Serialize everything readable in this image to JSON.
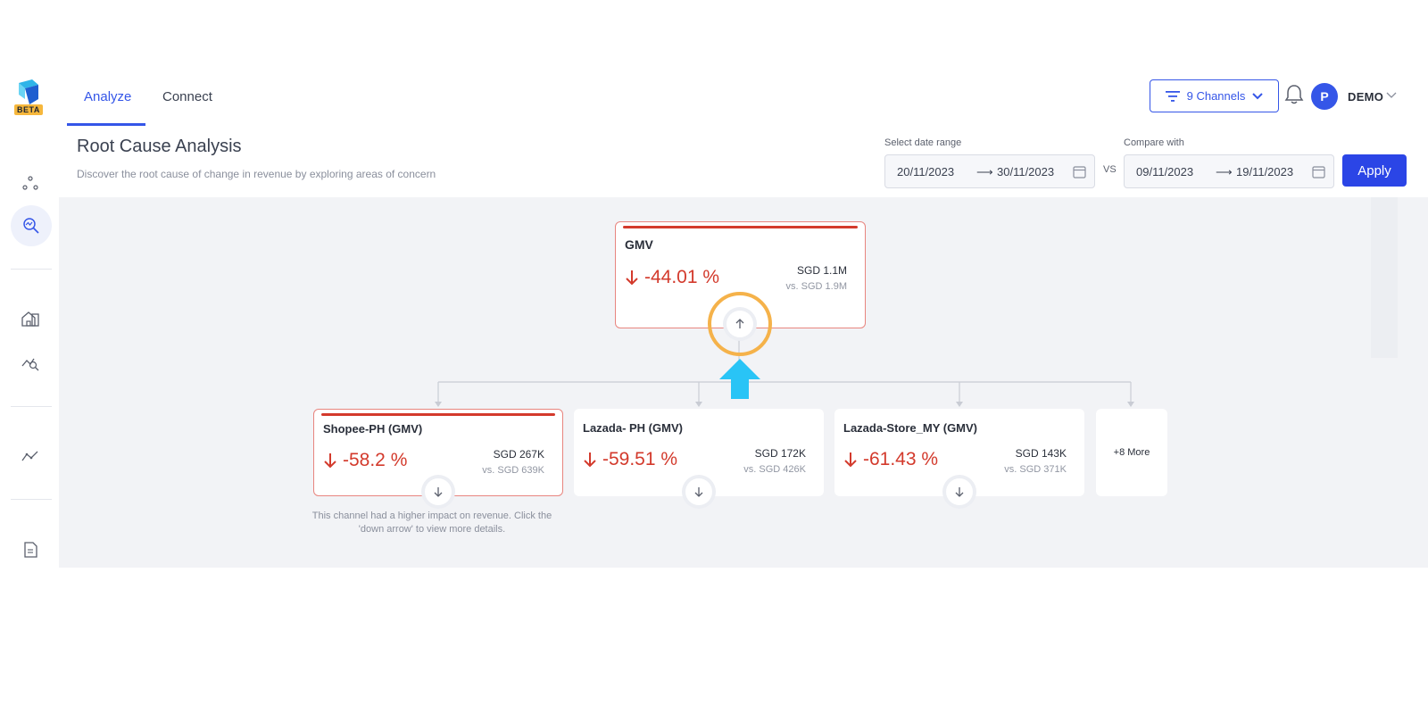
{
  "nav": {
    "beta_badge": "BETA",
    "tabs": [
      {
        "label": "Analyze"
      },
      {
        "label": "Connect"
      }
    ],
    "channels_label": "9 Channels",
    "avatar_initial": "P",
    "user_name": "DEMO"
  },
  "header": {
    "title": "Root Cause Analysis",
    "subtitle": "Discover the root cause of change in revenue by exploring areas of concern",
    "date_range_label": "Select date range",
    "date_from": "20/11/2023",
    "date_to": "30/11/2023",
    "vs_label": "VS",
    "compare_label": "Compare with",
    "compare_from": "09/11/2023",
    "compare_to": "19/11/2023",
    "apply_label": "Apply",
    "arrow": "⟶"
  },
  "root_card": {
    "name": "GMV",
    "change": "-44.01 %",
    "value": "SGD 1.1M",
    "compare": "vs. SGD 1.9M"
  },
  "children": [
    {
      "name": "Shopee-PH (GMV)",
      "change": "-58.2 %",
      "value": "SGD 267K",
      "compare": "vs. SGD 639K"
    },
    {
      "name": "Lazada- PH (GMV)",
      "change": "-59.51 %",
      "value": "SGD 172K",
      "compare": "vs. SGD 426K"
    },
    {
      "name": "Lazada-Store_MY (GMV)",
      "change": "-61.43 %",
      "value": "SGD 143K",
      "compare": "vs. SGD 371K"
    }
  ],
  "more_label": "+8 More",
  "hint": "This channel had a higher impact on revenue. Click the 'down arrow' to view more details.",
  "colors": {
    "accent": "#3556e8",
    "negative": "#d33a2c",
    "highlight_ring": "#f5b24a",
    "pointer_arrow": "#29c4f6"
  }
}
